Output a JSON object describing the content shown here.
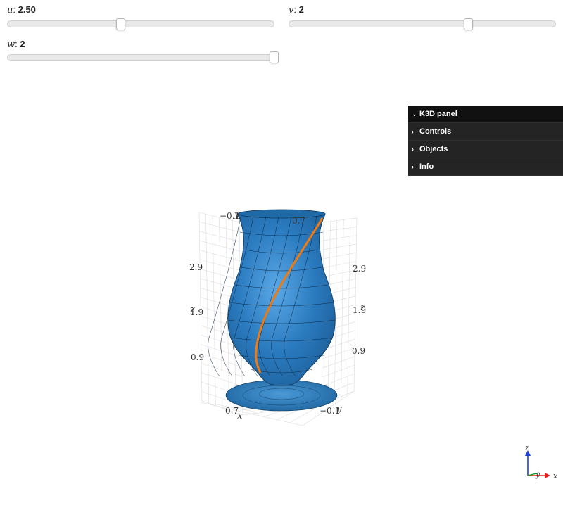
{
  "sliders": {
    "u": {
      "name": "u",
      "value": "2.50",
      "fraction": 0.42
    },
    "v": {
      "name": "v",
      "value": "2",
      "fraction": 0.67
    },
    "w": {
      "name": "w",
      "value": "2",
      "fraction": 1.0
    }
  },
  "panel": {
    "title": "K3D panel",
    "items": [
      "Controls",
      "Objects",
      "Info"
    ]
  },
  "plot": {
    "tick_labels": {
      "left_z": [
        "2.9",
        "1.9",
        "0.9"
      ],
      "right_z": [
        "2.9",
        "1.9",
        "0.9"
      ],
      "top_y": "−0.1",
      "top_x": "0.7",
      "bottom_x": "0.7",
      "bottom_y": "−0.1"
    },
    "axis_labels": {
      "x": "x",
      "y": "y",
      "z": "z"
    },
    "surface_color": "#2b7bc0",
    "curve_color": "#f07a10"
  },
  "orientation": {
    "x": "x",
    "y": "y",
    "z": "z"
  }
}
